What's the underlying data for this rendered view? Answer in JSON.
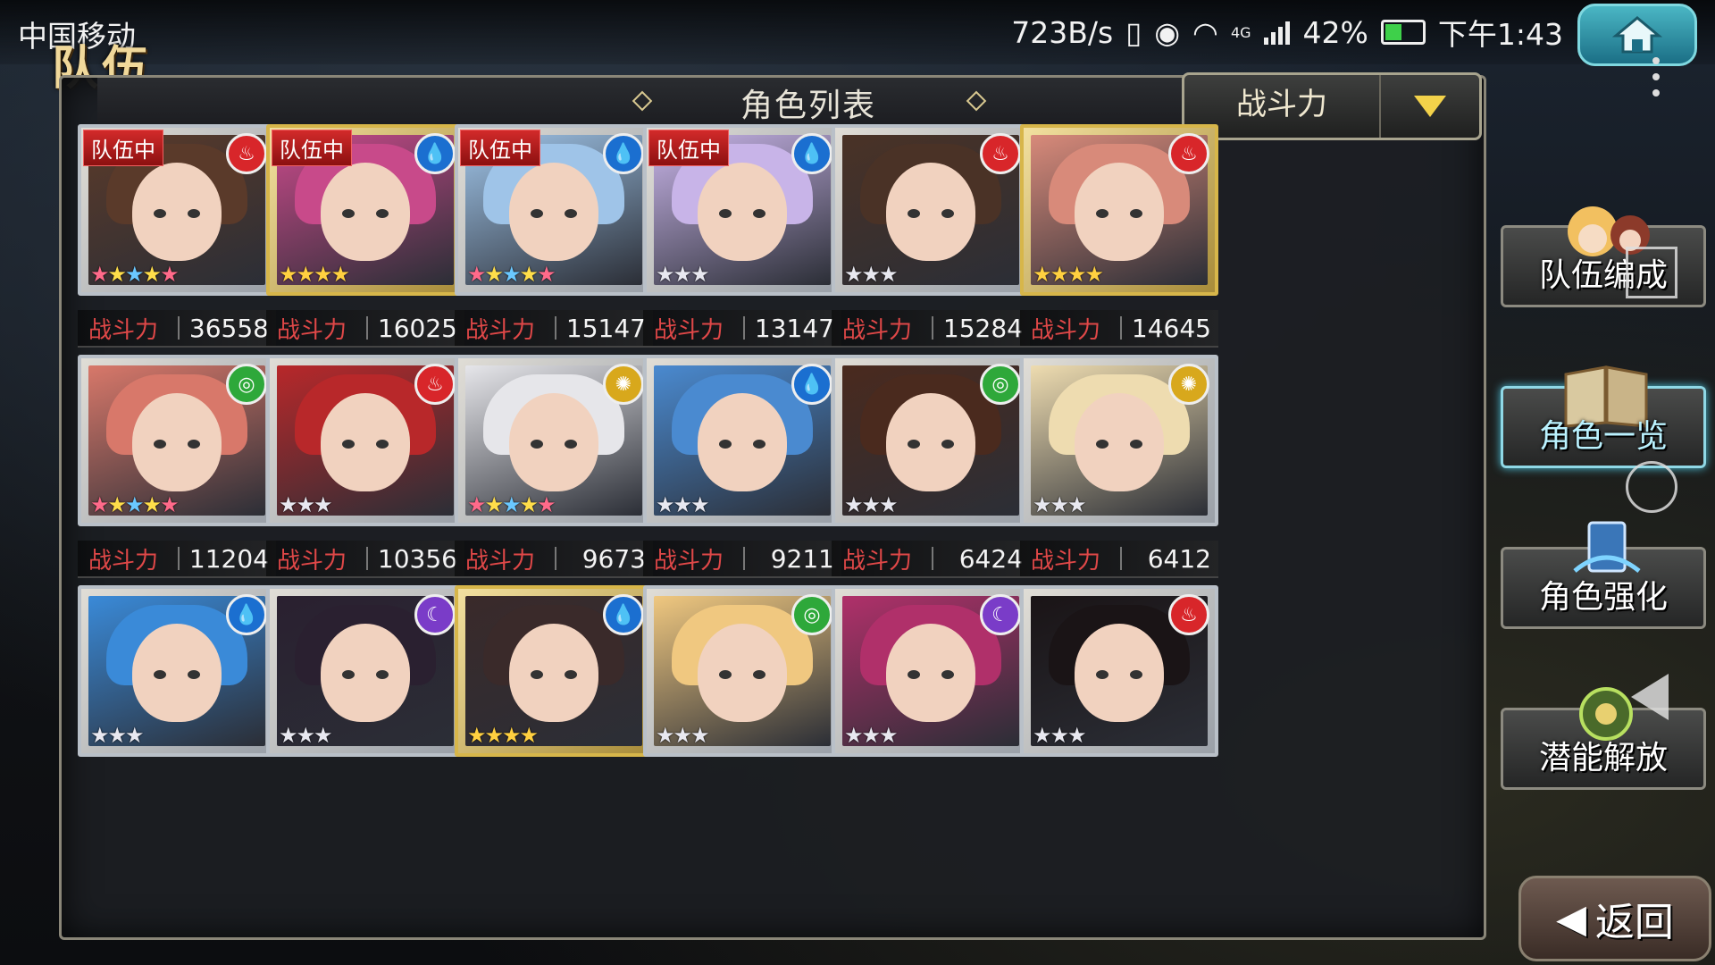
{
  "status_bar": {
    "carrier": "中国移动",
    "speed": "723B/s",
    "network": "4G",
    "battery": "42%",
    "time": "下午1:43"
  },
  "screen_title": "队伍",
  "panel": {
    "title": "角色列表",
    "sort_label": "战斗力"
  },
  "power_label": "战斗力",
  "team_badge": "队伍中",
  "characters": [
    {
      "power": "36558",
      "in_team": true,
      "element": "fire",
      "stars": 5,
      "frame": "silver"
    },
    {
      "power": "16025",
      "in_team": true,
      "element": "water",
      "stars": 4,
      "frame": "gold"
    },
    {
      "power": "15147",
      "in_team": true,
      "element": "water",
      "stars": 5,
      "frame": "silver"
    },
    {
      "power": "13147",
      "in_team": true,
      "element": "water",
      "stars": 3,
      "frame": "silver"
    },
    {
      "power": "15284",
      "in_team": false,
      "element": "fire",
      "stars": 3,
      "frame": "silver"
    },
    {
      "power": "14645",
      "in_team": false,
      "element": "fire",
      "stars": 4,
      "frame": "gold"
    },
    {
      "power": "11204",
      "in_team": false,
      "element": "wind",
      "stars": 5,
      "frame": "silver"
    },
    {
      "power": "10356",
      "in_team": false,
      "element": "fire",
      "stars": 3,
      "frame": "silver"
    },
    {
      "power": "9673",
      "in_team": false,
      "element": "light",
      "stars": 5,
      "frame": "silver"
    },
    {
      "power": "9211",
      "in_team": false,
      "element": "water",
      "stars": 3,
      "frame": "silver"
    },
    {
      "power": "6424",
      "in_team": false,
      "element": "wind",
      "stars": 3,
      "frame": "silver"
    },
    {
      "power": "6412",
      "in_team": false,
      "element": "light",
      "stars": 3,
      "frame": "silver"
    },
    {
      "power": "",
      "in_team": false,
      "element": "water",
      "stars": 3,
      "frame": "silver"
    },
    {
      "power": "",
      "in_team": false,
      "element": "dark",
      "stars": 3,
      "frame": "silver"
    },
    {
      "power": "",
      "in_team": false,
      "element": "water",
      "stars": 4,
      "frame": "gold"
    },
    {
      "power": "",
      "in_team": false,
      "element": "wind",
      "stars": 3,
      "frame": "silver"
    },
    {
      "power": "",
      "in_team": false,
      "element": "dark",
      "stars": 3,
      "frame": "silver"
    },
    {
      "power": "",
      "in_team": false,
      "element": "fire",
      "stars": 3,
      "frame": "silver"
    }
  ],
  "side_menu": [
    {
      "label": "队伍编成",
      "active": false
    },
    {
      "label": "角色一览",
      "active": true
    },
    {
      "label": "角色强化",
      "active": false
    },
    {
      "label": "潜能解放",
      "active": false
    }
  ],
  "return_label": "返回",
  "colors": {
    "fire": "#d8262a",
    "water": "#1b6fd0",
    "wind": "#2ea83a",
    "light": "#d8a81c",
    "dark": "#7a3cc8",
    "power_label": "#e04848",
    "active_accent": "#8fd8e6"
  }
}
